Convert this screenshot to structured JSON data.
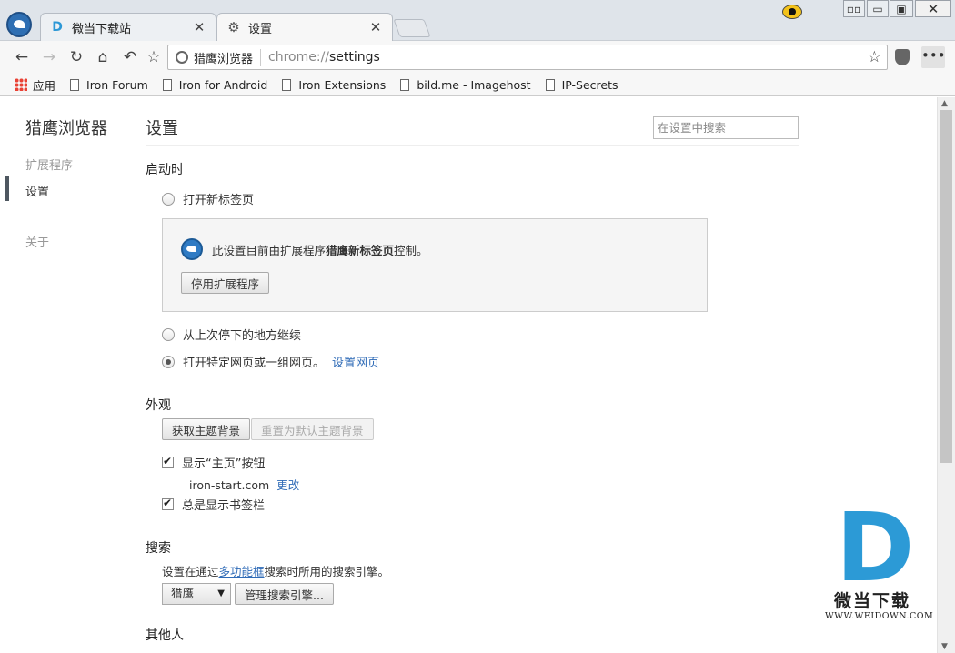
{
  "tabs": [
    {
      "label": "微当下载站",
      "icon": "weidown-d-icon"
    },
    {
      "label": "设置",
      "icon": "gear-icon"
    }
  ],
  "window_controls": {
    "close": "✕"
  },
  "toolbar": {
    "site_name": "猎鹰浏览器",
    "url_scheme": "chrome://",
    "url_path": "settings"
  },
  "bookmarks": [
    {
      "label": "应用",
      "icon": "apps-icon"
    },
    {
      "label": "Iron Forum",
      "icon": "page-icon"
    },
    {
      "label": "Iron for Android",
      "icon": "page-icon"
    },
    {
      "label": "Iron Extensions",
      "icon": "page-icon"
    },
    {
      "label": "bild.me - Imagehost",
      "icon": "page-icon"
    },
    {
      "label": "IP-Secrets",
      "icon": "page-icon"
    }
  ],
  "sidebar": {
    "title": "猎鹰浏览器",
    "items": [
      {
        "label": "扩展程序",
        "active": false
      },
      {
        "label": "设置",
        "active": true
      },
      {
        "label": "关于",
        "active": false
      }
    ]
  },
  "main": {
    "title": "设置",
    "search_placeholder": "在设置中搜索",
    "startup": {
      "heading": "启动时",
      "opt_new_tab": "打开新标签页",
      "ext_notice_prefix": "此设置目前由扩展程序",
      "ext_name": "猎鹰新标签页",
      "ext_notice_suffix": "控制。",
      "disable_ext_button": "停用扩展程序",
      "opt_continue": "从上次停下的地方继续",
      "opt_specific": "打开特定网页或一组网页。",
      "set_pages_link": "设置网页",
      "selected": "opt_specific"
    },
    "appearance": {
      "heading": "外观",
      "get_themes_button": "获取主题背景",
      "reset_theme_button": "重置为默认主题背景",
      "show_home_label": "显示“主页”按钮",
      "show_home_checked": true,
      "home_url": "iron-start.com",
      "change_link": "更改",
      "show_bookmarks_label": "总是显示书签栏",
      "show_bookmarks_checked": true
    },
    "search": {
      "heading": "搜索",
      "desc_prefix": "设置在通过",
      "desc_link": "多功能框",
      "desc_suffix": "搜索时所用的搜索引擎。",
      "engine_selected": "猎鹰",
      "manage_button": "管理搜索引擎..."
    },
    "others": {
      "heading": "其他人"
    }
  },
  "watermark": {
    "letter": "D",
    "cn": "微当下载",
    "en": "WWW.WEIDOWN.COM"
  },
  "colors": {
    "link": "#2f6bb7",
    "watermark_blue": "#2c9ad6",
    "tabstrip": "#dfe4ea"
  }
}
